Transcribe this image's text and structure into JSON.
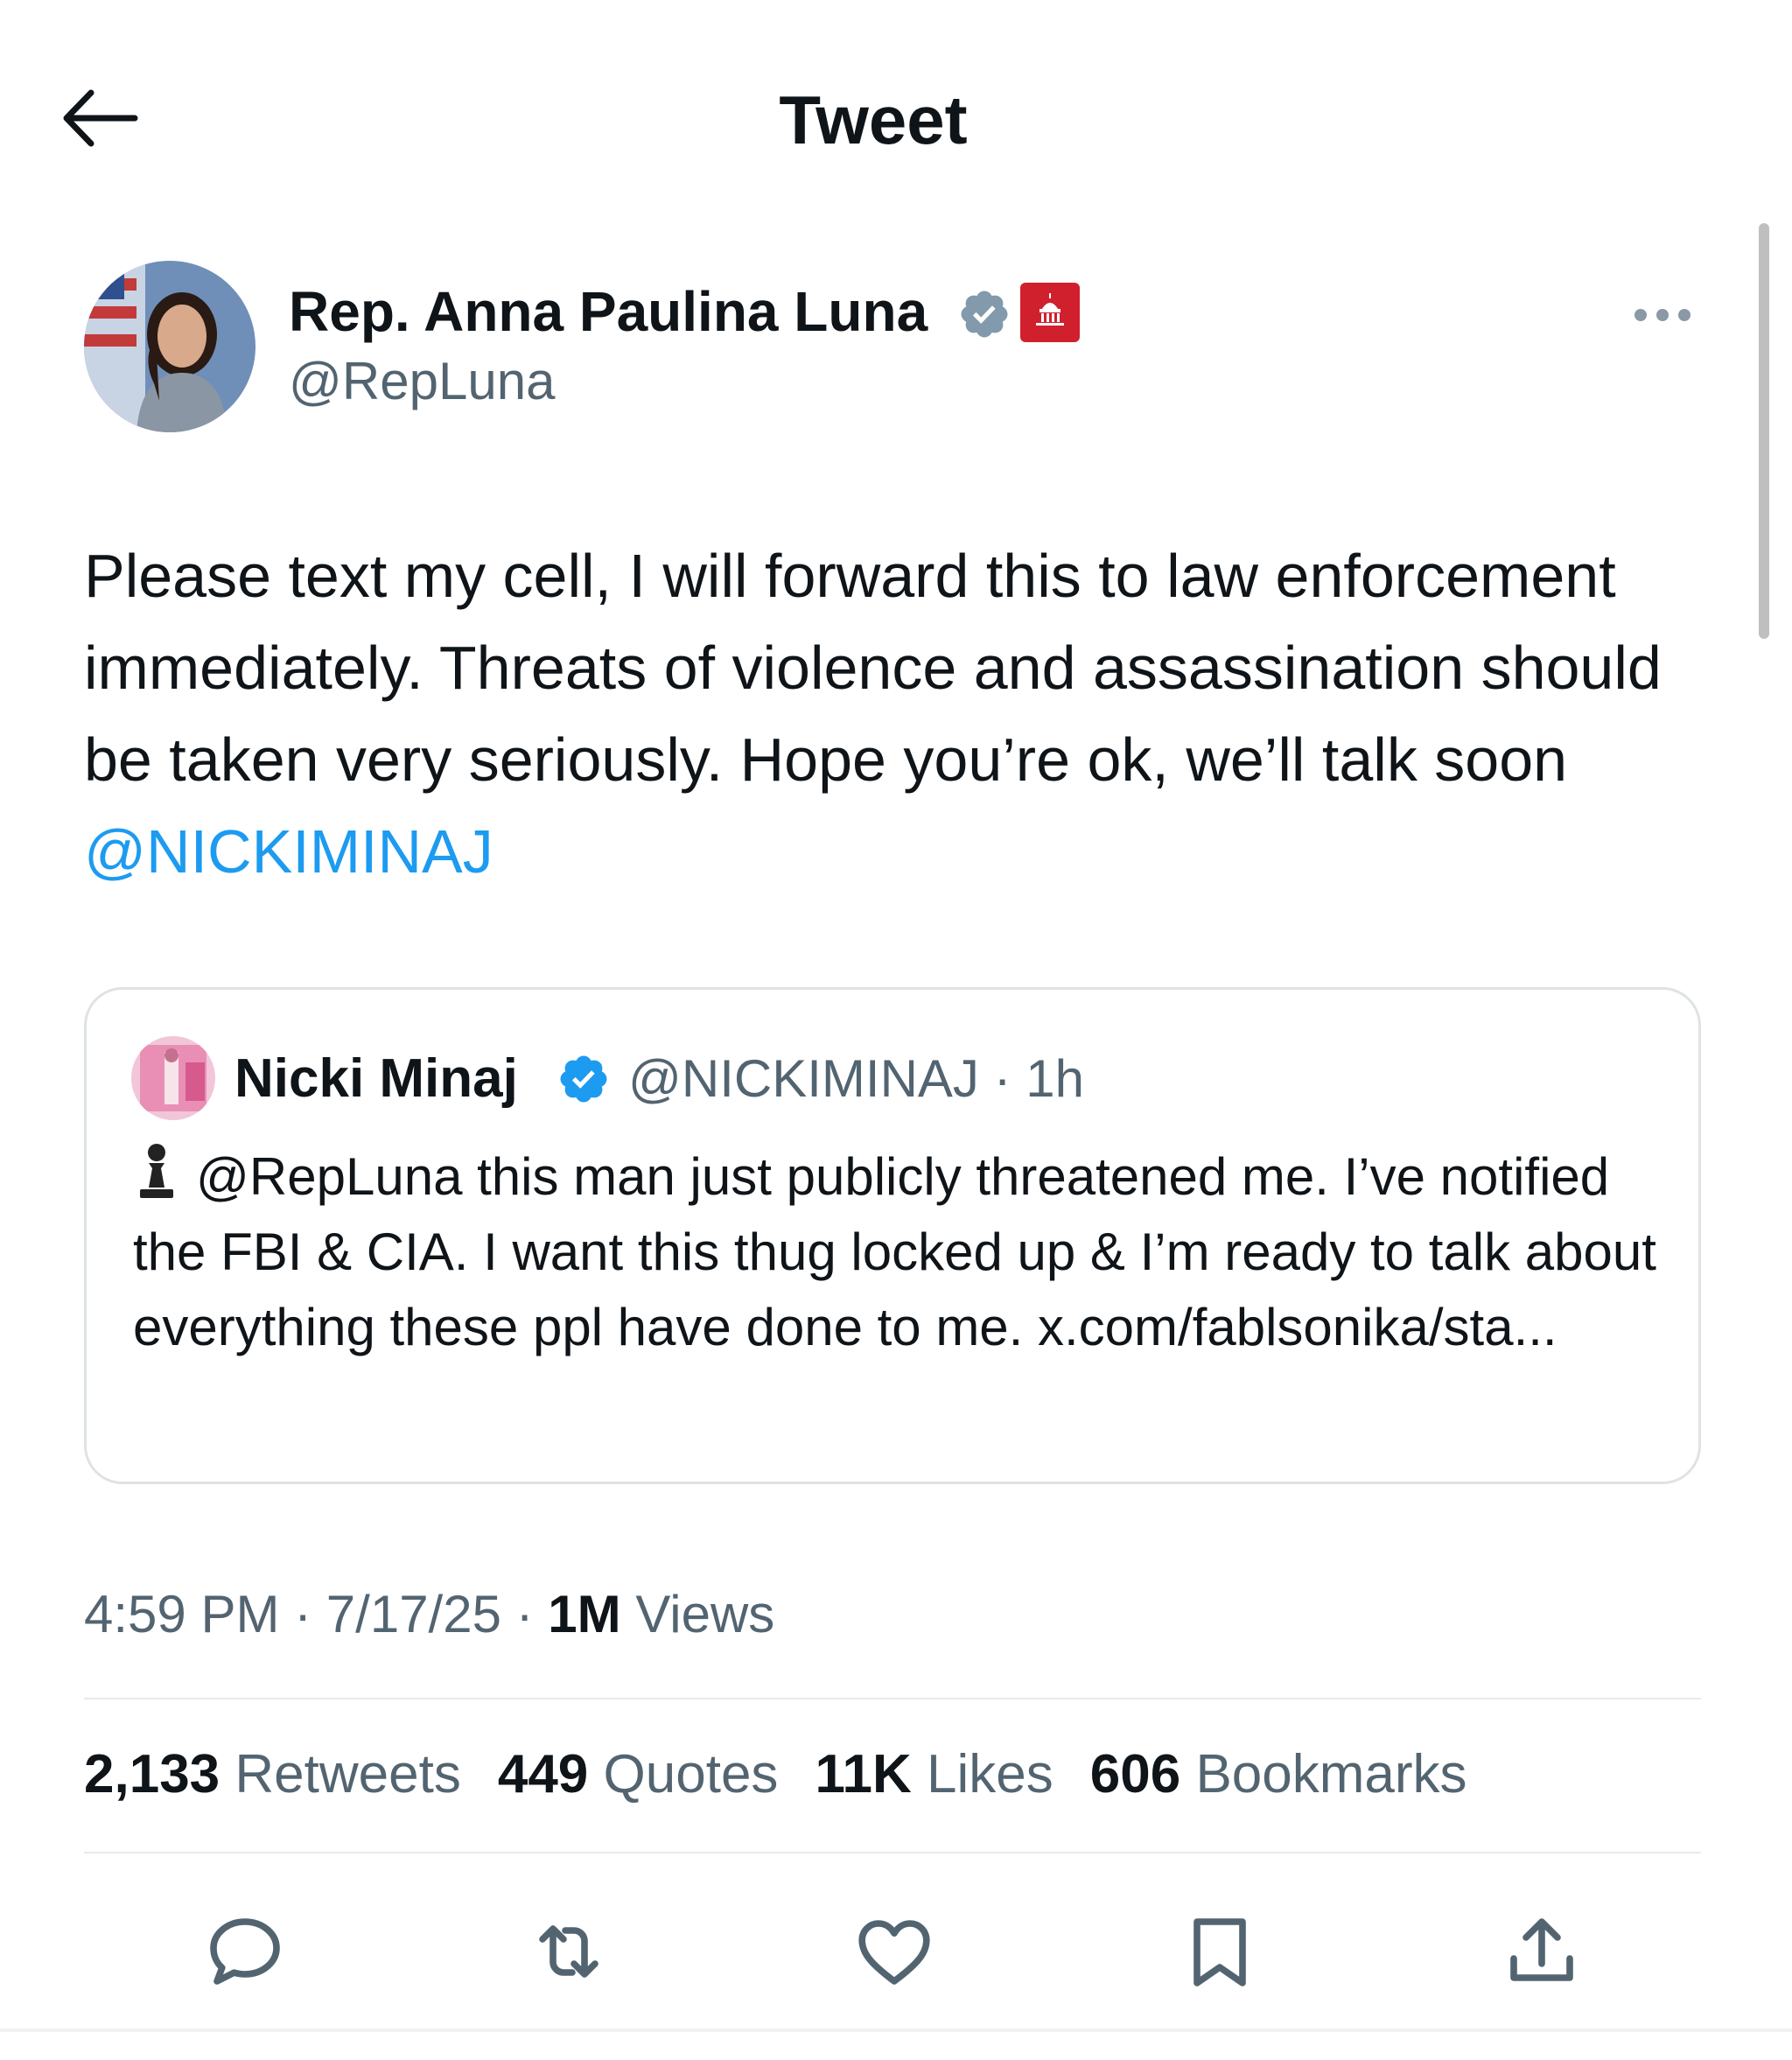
{
  "header": {
    "title": "Tweet",
    "back_icon": "arrow-left-icon"
  },
  "author": {
    "name": "Rep. Anna Paulina Luna",
    "handle": "@RepLuna",
    "verified_color": "#829aab",
    "affiliation_badge_color": "#d0202e"
  },
  "tweet": {
    "text_main": "Please text my cell, I will forward this to law enforcement immediately. Threats of violence and assassination should be taken very seriously. Hope you’re ok, we’ll talk soon ",
    "mention": "@NICKIMINAJ",
    "mention_color": "#1d9bf0"
  },
  "quote": {
    "name": "Nicki Minaj",
    "handle": "@NICKIMINAJ",
    "separator": "·",
    "age": "1h",
    "verified_color": "#1d9bf0",
    "text": "@RepLuna this man just publicly threatened me. I’ve notified the FBI & CIA. I want this thug locked up & I’m ready to talk about everything these ppl have done to me. x.com/fablsonika/sta..."
  },
  "meta": {
    "time": "4:59 PM",
    "date": "7/17/25",
    "sep": "·",
    "views_count": "1M",
    "views_label": "Views"
  },
  "stats": [
    {
      "value": "2,133",
      "label": "Retweets"
    },
    {
      "value": "449",
      "label": "Quotes"
    },
    {
      "value": "11K",
      "label": "Likes"
    },
    {
      "value": "606",
      "label": "Bookmarks"
    }
  ],
  "actions": [
    "reply-icon",
    "retweet-icon",
    "like-icon",
    "bookmark-icon",
    "share-icon"
  ]
}
